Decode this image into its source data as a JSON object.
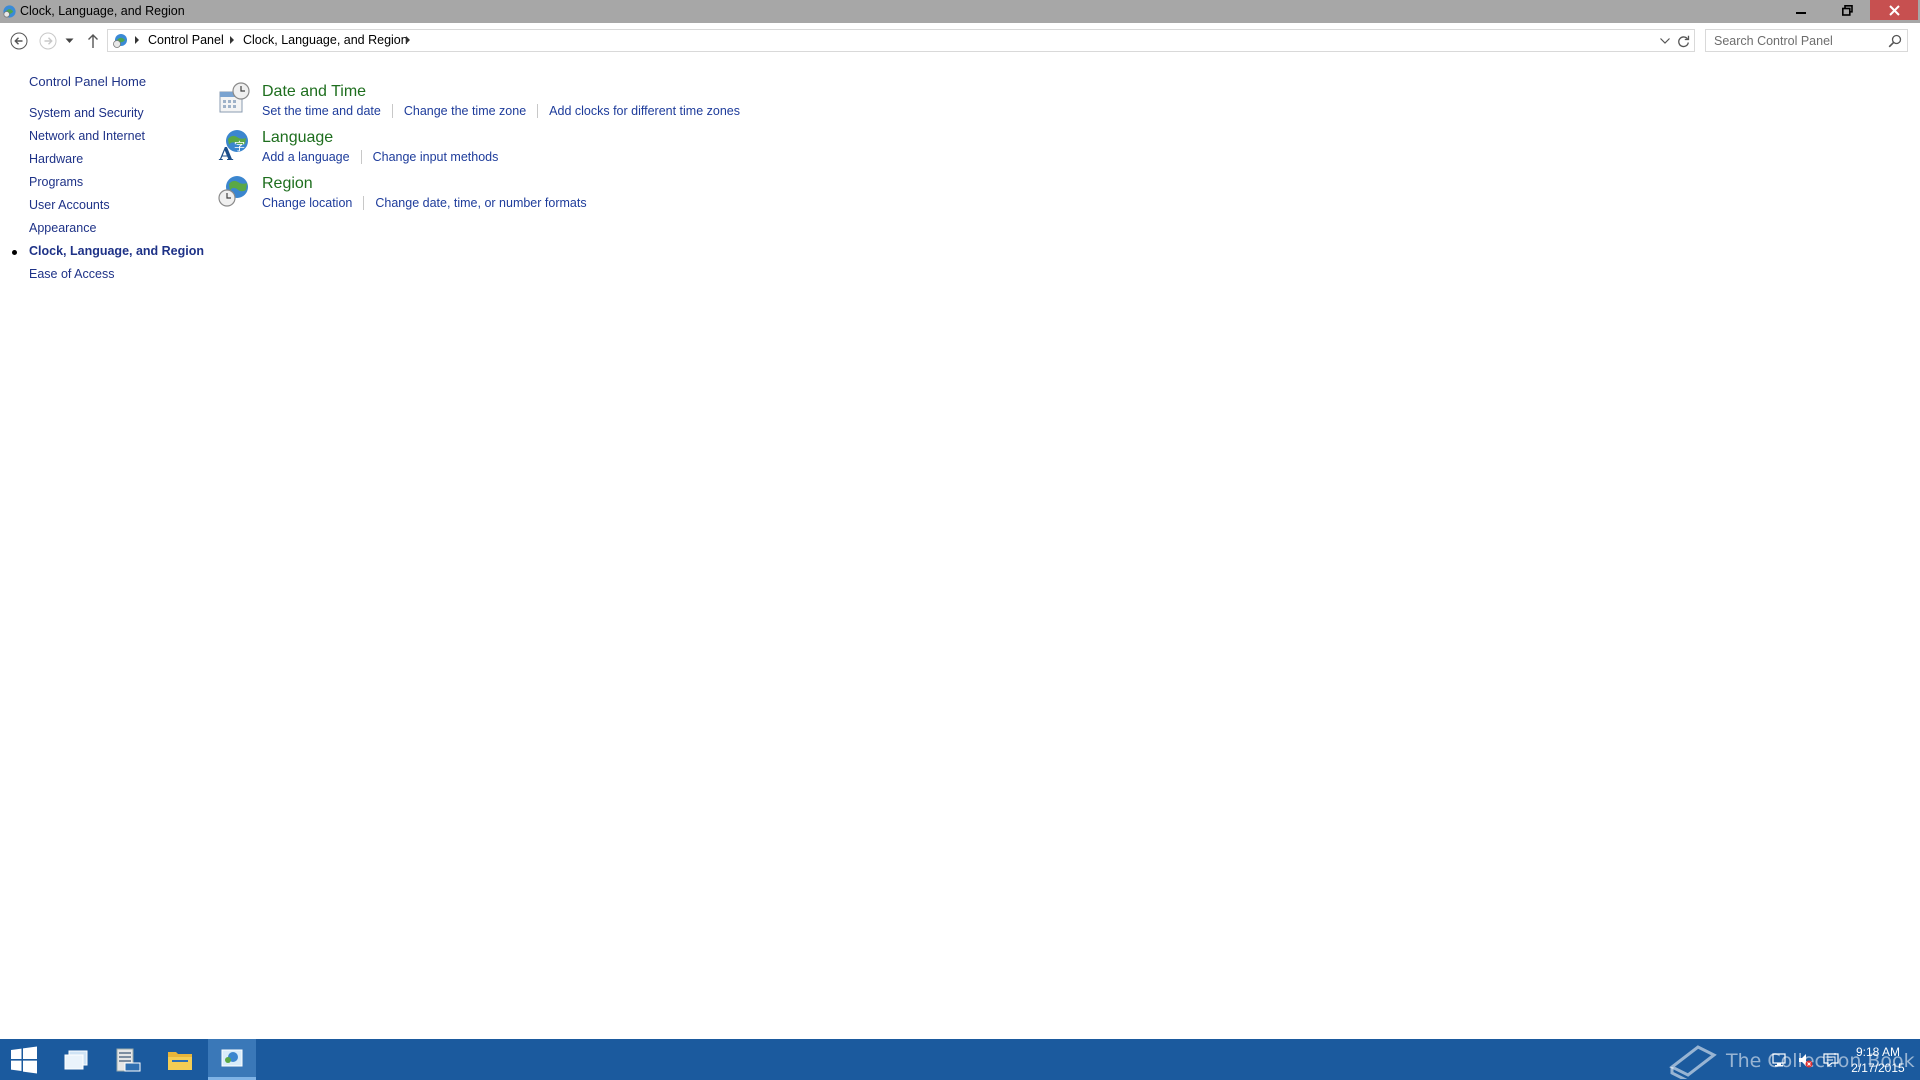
{
  "window": {
    "title": "Clock, Language, and Region",
    "controls": {
      "minimize": "minimize",
      "maximize": "restore",
      "close": "close"
    }
  },
  "navbar": {
    "breadcrumb": [
      "Control Panel",
      "Clock, Language, and Region"
    ],
    "search_placeholder": "Search Control Panel"
  },
  "sidebar": {
    "home": "Control Panel Home",
    "items": [
      {
        "label": "System and Security",
        "current": false
      },
      {
        "label": "Network and Internet",
        "current": false
      },
      {
        "label": "Hardware",
        "current": false
      },
      {
        "label": "Programs",
        "current": false
      },
      {
        "label": "User Accounts",
        "current": false
      },
      {
        "label": "Appearance",
        "current": false
      },
      {
        "label": "Clock, Language, and Region",
        "current": true
      },
      {
        "label": "Ease of Access",
        "current": false
      }
    ]
  },
  "content": {
    "sections": [
      {
        "title": "Date and Time",
        "icon": "date-time-icon",
        "links": [
          "Set the time and date",
          "Change the time zone",
          "Add clocks for different time zones"
        ]
      },
      {
        "title": "Language",
        "icon": "language-icon",
        "links": [
          "Add a language",
          "Change input methods"
        ]
      },
      {
        "title": "Region",
        "icon": "region-icon",
        "links": [
          "Change location",
          "Change date, time, or number formats"
        ]
      }
    ]
  },
  "taskbar": {
    "time": "9:18 AM",
    "date": "2/17/2015",
    "watermark": "The Collection Book"
  },
  "colors": {
    "titlebar": "#a7a7a7",
    "link": "#1e3287",
    "section_title": "#1e6e1e",
    "taskbar": "#1b5a9e",
    "close": "#c75050"
  }
}
